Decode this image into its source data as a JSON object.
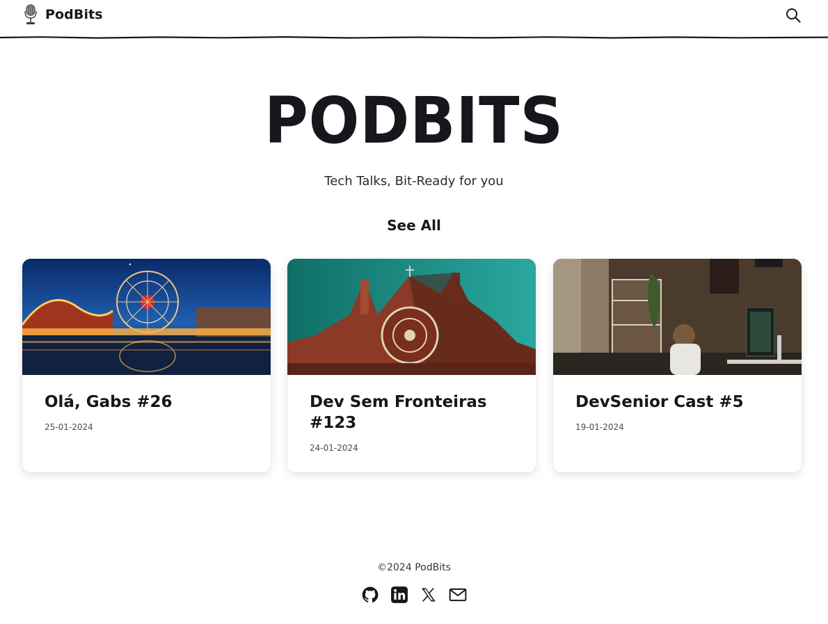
{
  "header": {
    "brand": "PodBits",
    "logo_icon": "microphone-icon",
    "search_icon": "search-icon"
  },
  "hero": {
    "title": "PODBITS",
    "subtitle": "Tech Talks, Bit-Ready for you",
    "see_all": "See All"
  },
  "cards": [
    {
      "title": "Olá, Gabs #26",
      "date": "25-01-2024",
      "image": "amusement-park-night-image"
    },
    {
      "title": "Dev Sem Fronteiras #123",
      "date": "24-01-2024",
      "image": "church-facade-image"
    },
    {
      "title": "DevSenior Cast #5",
      "date": "19-01-2024",
      "image": "child-at-computer-image"
    }
  ],
  "footer": {
    "copyright": "©2024 PodBits",
    "social_icons": [
      "github-icon",
      "linkedin-icon",
      "x-icon",
      "mail-icon"
    ]
  },
  "colors": {
    "text": "#16161d",
    "background": "#ffffff"
  }
}
